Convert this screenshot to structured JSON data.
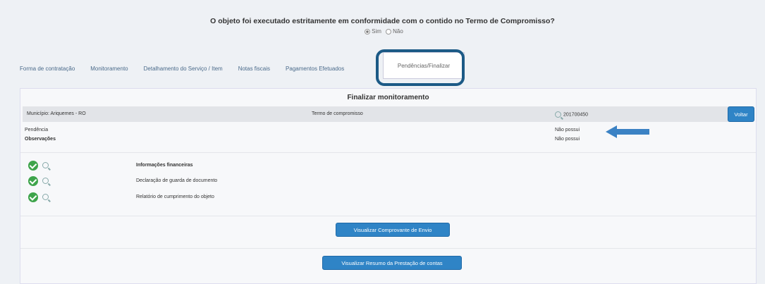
{
  "question": {
    "text": "O objeto foi executado estritamente em conformidade com o contido no Termo de Compromisso?",
    "options": [
      "Sim",
      "Não"
    ],
    "selected": "Sim"
  },
  "tabs": [
    "Forma de contratação",
    "Monitoramento",
    "Detalhamento do Serviço / Item",
    "Notas fiscais",
    "Pagamentos Efetuados",
    "Pendências/Finalizar"
  ],
  "active_tab": "Pendências/Finalizar",
  "panel": {
    "title": "Finalizar monitoramento",
    "municipio": "Município: Ariquemes - RO",
    "termo_label": "Termo de compromisso",
    "termo_value": "201700450",
    "voltar": "Voltar",
    "pendencia_label": "Pendência",
    "pendencia_value": "Não possui",
    "observacoes_label": "Observações",
    "observacoes_value": "Não possui",
    "documents": [
      "Informações financeiras",
      "Declaração de guarda de documento",
      "Relatório de cumprimento do objeto"
    ],
    "btn_comprovante": "Visualizar Comprovante de Envio",
    "btn_resumo": "Visualizar Resumo da Prestação de contas"
  },
  "colors": {
    "highlight": "#1c5a86",
    "arrow": "#3b82c4",
    "button": "#2f84c6",
    "check": "#3ea44b"
  }
}
